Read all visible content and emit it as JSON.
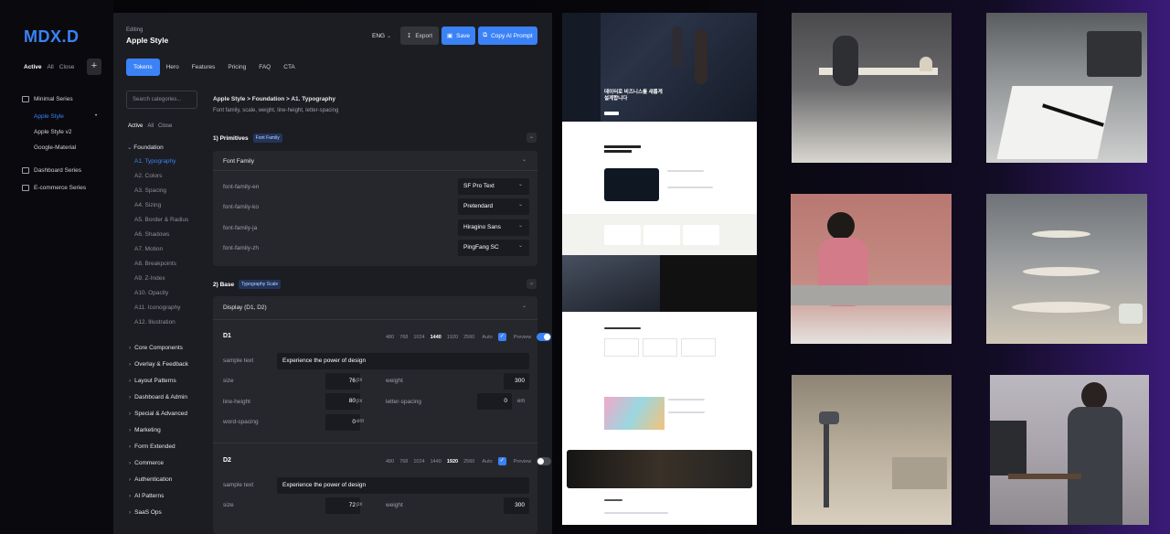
{
  "app": {
    "logo": "MDX.D",
    "filters": [
      "Active",
      "All",
      "Close"
    ],
    "add": "+"
  },
  "tree": {
    "groups": [
      {
        "label": "Minimal Series",
        "items": [
          {
            "label": "Apple Style",
            "active": true,
            "dot": "•"
          },
          {
            "label": "Apple Style v2"
          },
          {
            "label": "Google-Material"
          }
        ]
      },
      {
        "label": "Dashboard Series"
      },
      {
        "label": "E-commerce Series"
      }
    ]
  },
  "header": {
    "editing": "Editing",
    "title": "Apple Style",
    "lang": "ENG",
    "export": "Export",
    "save": "Save",
    "copy": "Copy AI Prompt"
  },
  "tabs": [
    "Tokens",
    "Hero",
    "Features",
    "Pricing",
    "FAQ",
    "CTA"
  ],
  "sidebar": {
    "search_placeholder": "Search categories...",
    "filters": [
      "Active",
      "All",
      "Close"
    ],
    "foundation": "Foundation",
    "foundation_items": [
      "A1. Typography",
      "A2. Colors",
      "A3. Spacing",
      "A4. Sizing",
      "A5. Border & Radius",
      "A6. Shadows",
      "A7. Motion",
      "A8. Breakpoints",
      "A9. Z-Index",
      "A10. Opacity",
      "A11. Iconography",
      "A12. Illustration"
    ],
    "categories": [
      "Core Components",
      "Overlay & Feedback",
      "Layout Patterns",
      "Dashboard & Admin",
      "Special & Advanced",
      "Marketing",
      "Form Extended",
      "Commerce",
      "Authentication",
      "AI Patterns",
      "SaaS Ops"
    ]
  },
  "content": {
    "breadcrumb": "Apple Style  >  Foundation  >  A1. Typography",
    "description": "Font family, scale, weight, line-height, letter-spacing",
    "primitives": {
      "title": "1) Primitives",
      "badge": "Font Family",
      "card": "Font Family",
      "fields": [
        {
          "label": "font-family-en",
          "value": "SF Pro Text"
        },
        {
          "label": "font-family-ko",
          "value": "Pretendard"
        },
        {
          "label": "font-family-ja",
          "value": "Hiragino Sans"
        },
        {
          "label": "font-family-zh",
          "value": "PingFang SC"
        }
      ]
    },
    "base": {
      "title": "2) Base",
      "badge": "Typography Scale",
      "card": "Display (D1, D2)"
    },
    "breakpoints": [
      "480",
      "768",
      "1024",
      "1440",
      "1920",
      "2560"
    ],
    "auto": "Auto",
    "preview": "Preview",
    "labels": {
      "sample": "sample text",
      "size": "size",
      "weight": "weight",
      "lh": "line-height",
      "ls": "letter-spacing",
      "ws": "word-spacing",
      "px": "px",
      "em": "em"
    },
    "d1": {
      "name": "D1",
      "active_bp": "1440",
      "preview_on": true,
      "sample": "Experience the power of design",
      "size": "76",
      "weight": "300",
      "line_height": "80",
      "letter_spacing": "0",
      "word_spacing": "0"
    },
    "d2": {
      "name": "D2",
      "active_bp": "1920",
      "preview_on": false,
      "sample": "Experience the power of design",
      "size": "72",
      "weight": "300"
    }
  },
  "preview": {
    "hero_title": "데이터로 비즈니스를 새롭게 설계합니다"
  },
  "colors": {
    "accent": "#3b82f6",
    "panel": "#1c1d22",
    "card": "#26272d"
  }
}
